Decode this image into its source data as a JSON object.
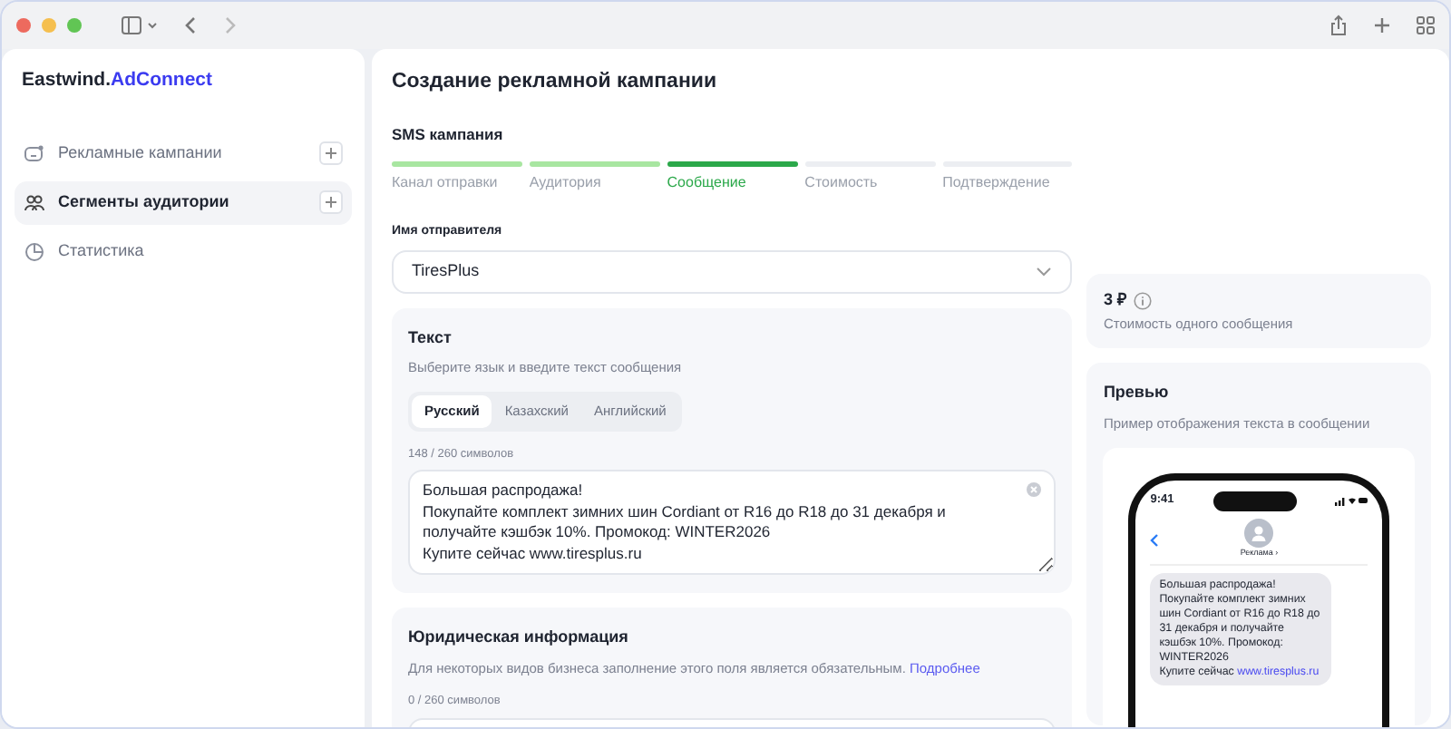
{
  "logo": {
    "brand": "Eastwind.",
    "product": "AdConnect"
  },
  "sidebar": {
    "items": [
      {
        "label": "Рекламные кампании",
        "kind": "campaigns",
        "selected": false,
        "has_add": true
      },
      {
        "label": "Сегменты аудитории",
        "kind": "segments",
        "selected": true,
        "has_add": true
      },
      {
        "label": "Статистика",
        "kind": "stats",
        "selected": false,
        "has_add": false
      }
    ]
  },
  "page_title": "Создание рекламной кампании",
  "campaign_type": "SMS кампания",
  "steps": [
    {
      "label": "Канал отправки",
      "completed": true,
      "selected": false
    },
    {
      "label": "Аудитория",
      "completed": true,
      "selected": false
    },
    {
      "label": "Сообщение",
      "completed": false,
      "selected": true
    },
    {
      "label": "Стоимость",
      "completed": false,
      "selected": false
    },
    {
      "label": "Подтверждение",
      "completed": false,
      "selected": false
    }
  ],
  "sender": {
    "label": "Имя отправителя",
    "value": "TiresPlus"
  },
  "text_section": {
    "title": "Текст",
    "description": "Выберите язык и введите текст сообщения",
    "languages": [
      {
        "label": "Русский",
        "selected": true
      },
      {
        "label": "Казахский",
        "selected": false
      },
      {
        "label": "Английский",
        "selected": false
      }
    ],
    "counter": "148 / 260 символов",
    "value": "Большая распродажа!\nПокупайте комплект зимних шин Cordiant от R16 до R18 до 31 декабря и получайте кэшбэк 10%. Промокод: WINTER2026\nКупите сейчас www.tiresplus.ru"
  },
  "legal_section": {
    "title": "Юридическая информация",
    "description": "Для некоторых видов бизнеса заполнение этого поля является обязательным.",
    "link": "Подробнее",
    "counter": "0 / 260 символов"
  },
  "cost": {
    "value": "3 ₽",
    "label": "Стоимость одного сообщения"
  },
  "preview": {
    "title": "Превью",
    "description": "Пример отображения текста в сообщении",
    "time": "9:41",
    "contact": "Реклама ›",
    "bubble_text": "Большая распродажа!\nПокупайте комплект зимних шин Cordiant от R16 до R18 до 31 декабря и получайте кэшбэк 10%. Промокод: WINTER2026\nКупите сейчас ",
    "bubble_link": "www.tiresplus.ru"
  }
}
